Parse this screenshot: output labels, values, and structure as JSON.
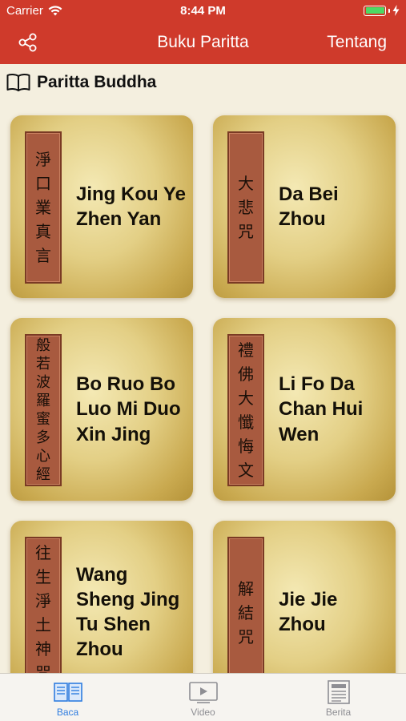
{
  "status_bar": {
    "carrier": "Carrier",
    "time": "8:44 PM",
    "wifi_icon": "wifi-icon",
    "battery_icon": "battery-icon",
    "charging_icon": "bolt-icon"
  },
  "nav": {
    "title": "Buku Paritta",
    "right_button": "Tentang",
    "left_icon": "share-icon"
  },
  "section": {
    "title": "Paritta Buddha",
    "icon": "open-book-icon"
  },
  "cards": [
    {
      "label": "淨口業真言",
      "title": "Jing Kou Ye Zhen Yan"
    },
    {
      "label": "大悲咒",
      "title": "Da Bei Zhou"
    },
    {
      "label": "般若波羅蜜多心經",
      "title": "Bo Ruo Bo Luo Mi Duo Xin Jing"
    },
    {
      "label": "禮佛大懺悔文",
      "title": "Li Fo Da Chan Hui Wen"
    },
    {
      "label": "往生淨土神咒",
      "title": "Wang Sheng Jing Tu Shen Zhou"
    },
    {
      "label": "解結咒",
      "title": "Jie Jie Zhou"
    }
  ],
  "tabs": [
    {
      "label": "Baca",
      "icon": "book-tab-icon",
      "active": true
    },
    {
      "label": "Video",
      "icon": "video-tab-icon",
      "active": false
    },
    {
      "label": "Berita",
      "icon": "newspaper-tab-icon",
      "active": false
    }
  ],
  "colors": {
    "header": "#cf3a2b",
    "background": "#f4efdf",
    "card_label": "#a85a3f",
    "tab_active": "#2f7de0",
    "tab_inactive": "#8e8e93"
  }
}
